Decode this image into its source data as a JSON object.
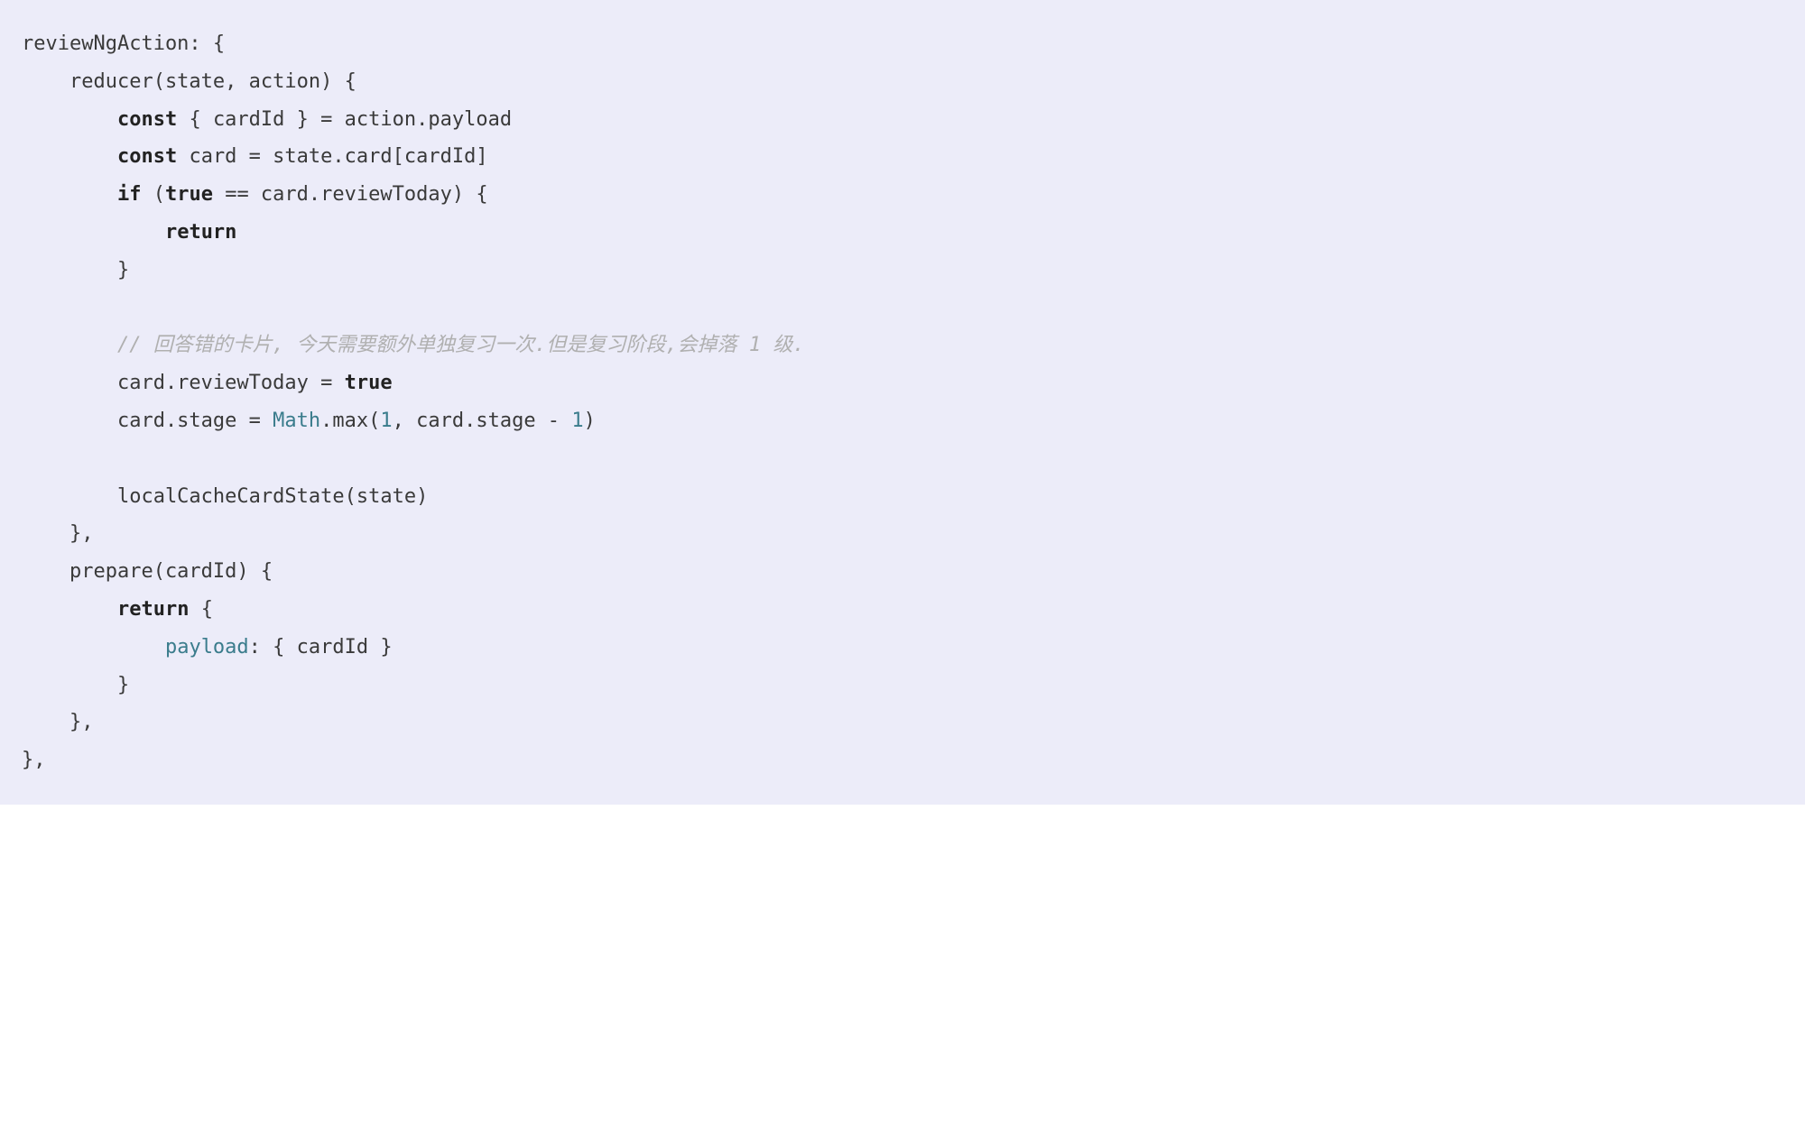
{
  "code": {
    "l1_a": "reviewNgAction: {",
    "l2_a": "    reducer(state, action) {",
    "l3_a": "        ",
    "l3_kw1": "const",
    "l3_b": " { cardId } = action.payload",
    "l4_a": "        ",
    "l4_kw1": "const",
    "l4_b": " card = state.card[cardId]",
    "l5_a": "        ",
    "l5_kw1": "if",
    "l5_b": " (",
    "l5_kw2": "true",
    "l5_c": " == card.reviewToday) {",
    "l6_a": "            ",
    "l6_kw1": "return",
    "l7_a": "        }",
    "l8_a": "",
    "l9_a": "        ",
    "l9_comment": "// 回答错的卡片, 今天需要额外单独复习一次.但是复习阶段,会掉落 1 级.",
    "l10_a": "        card.reviewToday = ",
    "l10_kw1": "true",
    "l11_a": "        card.stage = ",
    "l11_cls": "Math",
    "l11_b": ".max(",
    "l11_num1": "1",
    "l11_c": ", card.stage - ",
    "l11_num2": "1",
    "l11_d": ")",
    "l12_a": "",
    "l13_a": "        localCacheCardState(state)",
    "l14_a": "    },",
    "l15_a": "    prepare(cardId) {",
    "l16_a": "        ",
    "l16_kw1": "return",
    "l16_b": " {",
    "l17_a": "            ",
    "l17_attr": "payload",
    "l17_b": ": { cardId }",
    "l18_a": "        }",
    "l19_a": "    },",
    "l20_a": "},"
  }
}
